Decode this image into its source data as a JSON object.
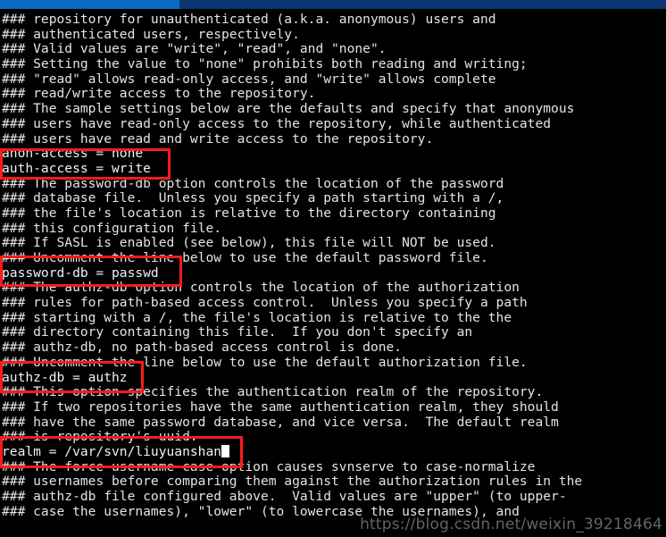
{
  "window": {
    "titlebar_active_color": "#0c6ac4",
    "titlebar_inactive_color": "#0a3570",
    "background_color": "#000000",
    "text_color": "#e8e8e8"
  },
  "terminal": {
    "file": "svnserve.conf",
    "cursor": {
      "visible": true,
      "shape": "block",
      "color": "#ffffff",
      "on_line": 29
    },
    "lines": [
      "### repository for unauthenticated (a.k.a. anonymous) users and",
      "### authenticated users, respectively.",
      "### Valid values are \"write\", \"read\", and \"none\".",
      "### Setting the value to \"none\" prohibits both reading and writing;",
      "### \"read\" allows read-only access, and \"write\" allows complete",
      "### read/write access to the repository.",
      "### The sample settings below are the defaults and specify that anonymous",
      "### users have read-only access to the repository, while authenticated",
      "### users have read and write access to the repository.",
      "anon-access = none",
      "auth-access = write",
      "### The password-db option controls the location of the password",
      "### database file.  Unless you specify a path starting with a /,",
      "### the file's location is relative to the directory containing",
      "### this configuration file.",
      "### If SASL is enabled (see below), this file will NOT be used.",
      "### Uncomment the line below to use the default password file.",
      "password-db = passwd",
      "### The authz-db option controls the location of the authorization",
      "### rules for path-based access control.  Unless you specify a path",
      "### starting with a /, the file's location is relative to the the",
      "### directory containing this file.  If you don't specify an",
      "### authz-db, no path-based access control is done.",
      "### Uncomment the line below to use the default authorization file.",
      "authz-db = authz",
      "### This option specifies the authentication realm of the repository.",
      "### If two repositories have the same authentication realm, they should",
      "### have the same password database, and vice versa.  The default realm",
      "### is repository's uuid.",
      "realm = /var/svn/liuyuanshan",
      "### The force-username-case option causes svnserve to case-normalize",
      "### usernames before comparing them against the authorization rules in the",
      "### authz-db file configured above.  Valid values are \"upper\" (to upper-",
      "### case the usernames), \"lower\" (to lowercase the usernames), and"
    ]
  },
  "annotations": {
    "color": "#ff1a1a",
    "boxes": [
      {
        "id": "redbox-access",
        "label": "access-settings-highlight"
      },
      {
        "id": "redbox-passworddb",
        "label": "password-db-highlight"
      },
      {
        "id": "redbox-authzdb",
        "label": "authz-db-highlight"
      },
      {
        "id": "redbox-realm",
        "label": "realm-highlight"
      }
    ]
  },
  "watermark": {
    "text": "https://blog.csdn.net/weixin_39218464"
  }
}
